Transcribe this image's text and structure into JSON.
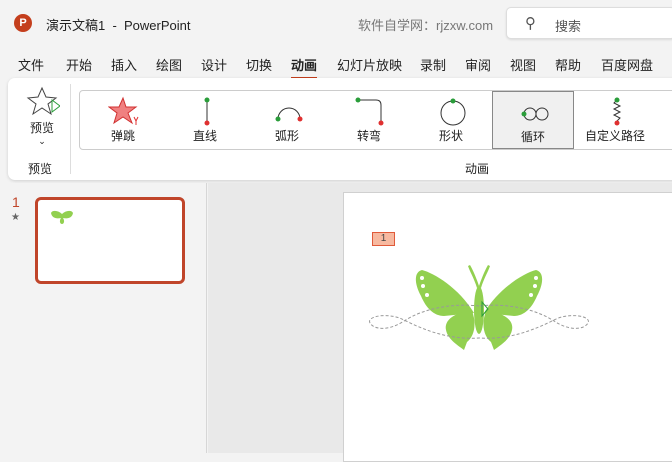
{
  "titlebar": {
    "app_title": "演示文稿1  -  PowerPoint",
    "site": "软件自学网：rjzxw.com",
    "search_placeholder": "搜索",
    "logo": "P"
  },
  "menu": [
    "文件",
    "开始",
    "插入",
    "绘图",
    "设计",
    "切换",
    "动画",
    "幻灯片放映",
    "录制",
    "审阅",
    "视图",
    "帮助",
    "百度网盘"
  ],
  "ribbon": {
    "preview_label": "预览",
    "preview_group": "预览",
    "animation_group": "动画",
    "gallery": [
      "弹跳",
      "直线",
      "弧形",
      "转弯",
      "形状",
      "循环",
      "自定义路径"
    ]
  },
  "thumbnail": {
    "number": "1",
    "star": "★"
  },
  "slide": {
    "animation_tag": "1"
  },
  "colors": {
    "accent": "#c43e1c",
    "butterfly": "#92d050"
  }
}
